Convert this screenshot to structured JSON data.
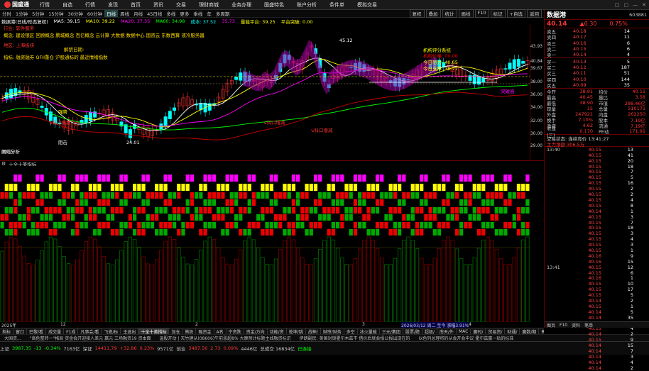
{
  "app": {
    "logo": "国盛通",
    "menu": [
      "行情",
      "自选",
      "行情",
      "发现",
      "首页",
      "资讯",
      "交易",
      "理财商城",
      "业务办理",
      "国盛特色",
      "账户分析",
      "条件单",
      "模拟交易"
    ],
    "controls": [
      "□",
      "▢",
      "—",
      "✕"
    ]
  },
  "timeframes": [
    "分时",
    "1分钟",
    "5分钟",
    "15分钟",
    "30分钟",
    "60分钟",
    "日线",
    "周线",
    "月线",
    "45日线",
    "多线",
    "更多",
    "季线",
    "年",
    "多周期"
  ],
  "toolbar_right": [
    "复权",
    "叠加",
    "统计",
    "画线",
    "F10",
    "标记",
    "+自选",
    "返回"
  ],
  "info_line": [
    {
      "t": "数据港(日线/形态复权)",
      "c": "#fff"
    },
    {
      "t": "MA5: 39.15",
      "c": "#fff"
    },
    {
      "t": "MA10: 39.22",
      "c": "#ff0"
    },
    {
      "t": "MA20: 37.35",
      "c": "#f0f"
    },
    {
      "t": "MA60: 34.98",
      "c": "#0f0"
    },
    {
      "t": "成本: 37.52",
      "c": "#0ff"
    },
    {
      "t": "35.73",
      "c": "#f0f"
    },
    {
      "t": "量能平台: 39.25",
      "c": "#ff0"
    },
    {
      "t": "平台突破: 0.00",
      "c": "#ff0"
    }
  ],
  "hot_labels": [
    {
      "t": "行业: 软件服务",
      "c": "#f33"
    },
    {
      "t": "概念: 建设银区 回顾概念 鹏城概念 百亿概念 云计算 大数据 数据中心 国资云 东数西算 液冷服务器",
      "c": "#fd0"
    },
    {
      "t": "地区: 上海板块",
      "c": "#f33"
    },
    {
      "t": "解禁日期:",
      "c": "#fd0"
    },
    {
      "t": "指标: 融资融券 QFII重仓 沪股通标的 最近情绪指数",
      "c": "#fd0"
    }
  ],
  "chart_annotations": [
    "45.12",
    "24.01",
    "机构评分系统",
    "机构价格: 00.00",
    "今日阻力: 40.65",
    "今日支撑: 38.77",
    "突破高",
    "↘科口增减",
    "↘科口增减",
    "↘科口增减",
    "强势",
    "阻击",
    "图线分析",
    "数据港主力流入"
  ],
  "right_axis": [
    "43.93",
    "40.84",
    "39.67",
    "38.00",
    "36.00",
    "34.00",
    "32.00",
    "30.00",
    "29.00"
  ],
  "volume_label": "100万",
  "indicator_title": "十全十美指标",
  "date_labels": [
    "2025年",
    "12",
    "2",
    "3",
    "4",
    "2026/03/12 周二 至今 漲幅3.91%"
  ],
  "tabs": [
    "指标",
    "窗口",
    "巴黎/看",
    "成交量",
    "F1成",
    "凡事会/看",
    "飞瓷/标",
    "主选出",
    "十全十美指标",
    "加仓",
    "熊奶",
    "融资金",
    "A名",
    "宁资跌",
    "资金/方向",
    "动能/资",
    "乾坤/跳",
    "战神/",
    "财审/财务",
    "多空",
    "冰火量能",
    "三元/集团",
    "股票/题",
    "超级/",
    "南天/外",
    "MAC",
    "赢时/",
    "贸易资/",
    "财通/",
    "赢数/期",
    "筹码/分布",
    "资金/赢"
  ],
  "news": [
    "大国资...",
    "\"高危整转一\"格局 资金会开迎接人差元 赢元·三场融资19 资本面",
    "温股开动 | 天竹建从(08606)午前涨超8% 大摩预计标题主线融资标识",
    "伊朗副民: 美国封锁霍尔木兹不 借价后就会报公报出现在的",
    "以色列总理将的从会开会中议 霍尔兹赢一贴的标准"
  ],
  "status": [
    {
      "t": "上证",
      "c": "#ccc"
    },
    {
      "t": "3987.35",
      "c": "#0f0"
    },
    {
      "t": "-13",
      "c": "#0f0"
    },
    {
      "t": "-0.34%",
      "c": "#0f0"
    },
    {
      "t": "7163亿",
      "c": "#ccc"
    },
    {
      "t": "深证",
      "c": "#ccc"
    },
    {
      "t": "14411.79",
      "c": "#f33"
    },
    {
      "t": "+32.86",
      "c": "#f33"
    },
    {
      "t": "0.23%",
      "c": "#f33"
    },
    {
      "t": "9571亿",
      "c": "#ccc"
    },
    {
      "t": "创业",
      "c": "#ccc"
    },
    {
      "t": "3487.56",
      "c": "#f33"
    },
    {
      "t": "2.73",
      "c": "#f33"
    },
    {
      "t": "0.09%",
      "c": "#f33"
    },
    {
      "t": "4446亿",
      "c": "#ccc"
    },
    {
      "t": "总成交 16834亿",
      "c": "#ccc"
    },
    {
      "t": "已连接",
      "c": "#0f0"
    }
  ],
  "panel": {
    "name": "数据港",
    "code": "603881",
    "price": "40.14",
    "change": "▲0.30",
    "change_pct": "0.75%",
    "asks": [
      [
        "卖五",
        "40.18",
        "14"
      ],
      [
        "卖四",
        "40.17",
        "11"
      ],
      [
        "卖三",
        "40.16",
        "6"
      ],
      [
        "卖二",
        "40.15",
        "6"
      ],
      [
        "卖一",
        "40.14",
        "4"
      ]
    ],
    "bids": [
      [
        "买一",
        "40.13",
        "5"
      ],
      [
        "买二",
        "40.12",
        "187"
      ],
      [
        "买三",
        "40.11",
        "51"
      ],
      [
        "买四",
        "40.10",
        "144"
      ],
      [
        "买五",
        "40.09",
        "35"
      ]
    ],
    "stats": [
      [
        "今开",
        "38.91",
        "均价",
        "40.11"
      ],
      [
        "最高",
        "40.45",
        "量比",
        "3.58"
      ],
      [
        "最低",
        "38.90",
        "市值",
        "288.46亿"
      ],
      [
        "现量",
        "15",
        "总量",
        "510171"
      ],
      [
        "外盘",
        "247921",
        "内盘",
        "262250"
      ],
      [
        "换手",
        "7.10%",
        "股本",
        "7.19亿"
      ],
      [
        "净资",
        "4.62",
        "流通",
        "7.19亿"
      ],
      [
        "收益(三)",
        "0.170",
        "PE动",
        "171.91"
      ]
    ],
    "trade_status": "交易状态: 连续竞价 13:41:27",
    "main_net": "主力净额 306.5万",
    "ticks": [
      [
        "13:40",
        "40.15",
        "13"
      ],
      [
        "",
        "40.15",
        "41"
      ],
      [
        "",
        "40.15",
        "20"
      ],
      [
        "",
        "40.15",
        "18"
      ],
      [
        "",
        "40.15",
        "7"
      ],
      [
        "",
        "40.15",
        "5"
      ],
      [
        "",
        "40.15",
        "16"
      ],
      [
        "",
        "40.15",
        "2"
      ],
      [
        "",
        "40.15",
        "2"
      ],
      [
        "",
        "40.15",
        "4"
      ],
      [
        "",
        "40.15",
        "8"
      ],
      [
        "",
        "40.14",
        "1"
      ],
      [
        "",
        "40.15",
        "3"
      ],
      [
        "",
        "40.15",
        "7"
      ],
      [
        "",
        "40.15",
        "18"
      ],
      [
        "",
        "40.15",
        "3"
      ],
      [
        "",
        "40.15",
        "4"
      ],
      [
        "",
        "40.15",
        "3"
      ],
      [
        "",
        "40.15",
        "1"
      ],
      [
        "",
        "40.16",
        "9"
      ],
      [
        "",
        "40.16",
        "15"
      ],
      [
        "13:41",
        "40.15",
        "12"
      ],
      [
        "",
        "40.15",
        "6"
      ],
      [
        "",
        "40.16",
        "1"
      ],
      [
        "",
        "40.15",
        "10"
      ],
      [
        "",
        "40.15",
        "17"
      ],
      [
        "",
        "40.15",
        "5"
      ],
      [
        "",
        "40.14",
        "2"
      ],
      [
        "",
        "40.15",
        "1"
      ],
      [
        "",
        "40.14",
        "5"
      ],
      [
        "",
        "40.14",
        "35"
      ],
      [
        "",
        "40.14",
        "7"
      ],
      [
        "",
        "40.15",
        "4"
      ],
      [
        "",
        "40.14",
        "2"
      ],
      [
        "",
        "40.15",
        "9"
      ],
      [
        "",
        "40.14",
        "15"
      ],
      [
        "",
        "40.14",
        "7"
      ],
      [
        "",
        "40.14",
        "3"
      ],
      [
        "",
        "40.14",
        "4"
      ],
      [
        "",
        "40.14",
        "2"
      ]
    ],
    "footer": [
      "图页",
      "F10",
      "资料",
      "笔单"
    ]
  }
}
